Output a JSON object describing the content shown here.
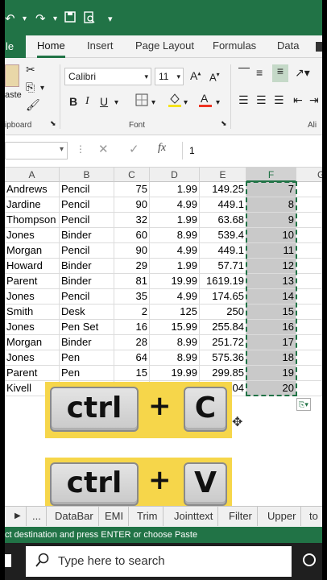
{
  "ribbon_tabs": [
    "le",
    "Home",
    "Insert",
    "Page Layout",
    "Formulas",
    "Data"
  ],
  "ribbon": {
    "font_name": "Calibri",
    "font_size": "11",
    "paste_label": "aste",
    "clipboard_label": "ipboard",
    "font_group_label": "Font",
    "alignment_label": "Ali"
  },
  "formula_bar": {
    "fx_label": "fx",
    "value": "1"
  },
  "columns": [
    "A",
    "B",
    "C",
    "D",
    "E",
    "F"
  ],
  "last_column_partial": "G",
  "rows": [
    [
      "Andrews",
      "Pencil",
      "75",
      "1.99",
      "149.25",
      "7"
    ],
    [
      "Jardine",
      "Pencil",
      "90",
      "4.99",
      "449.1",
      "8"
    ],
    [
      "Thompson",
      "Pencil",
      "32",
      "1.99",
      "63.68",
      "9"
    ],
    [
      "Jones",
      "Binder",
      "60",
      "8.99",
      "539.4",
      "10"
    ],
    [
      "Morgan",
      "Pencil",
      "90",
      "4.99",
      "449.1",
      "11"
    ],
    [
      "Howard",
      "Binder",
      "29",
      "1.99",
      "57.71",
      "12"
    ],
    [
      "Parent",
      "Binder",
      "81",
      "19.99",
      "1619.19",
      "13"
    ],
    [
      "Jones",
      "Pencil",
      "35",
      "4.99",
      "174.65",
      "14"
    ],
    [
      "Smith",
      "Desk",
      "2",
      "125",
      "250",
      "15"
    ],
    [
      "Jones",
      "Pen Set",
      "16",
      "15.99",
      "255.84",
      "16"
    ],
    [
      "Morgan",
      "Binder",
      "28",
      "8.99",
      "251.72",
      "17"
    ],
    [
      "Jones",
      "Pen",
      "64",
      "8.99",
      "575.36",
      "18"
    ],
    [
      "Parent",
      "Pen",
      "15",
      "19.99",
      "299.85",
      "19"
    ],
    [
      "Kivell",
      "",
      "",
      "",
      "04",
      "20"
    ]
  ],
  "overlay": {
    "key_ctrl": "ctrl",
    "plus": "+",
    "key_c": "C",
    "key_v": "V"
  },
  "sheet_tabs": [
    "...",
    "DataBar",
    "EMI",
    "Trim",
    "Jointtext",
    "Filter",
    "Upper",
    "to"
  ],
  "status_text": "ct destination and press ENTER or choose Paste",
  "taskbar": {
    "search_placeholder": "Type here to search"
  },
  "colors": {
    "excel_green": "#217346",
    "overlay_yellow": "#f6d64a",
    "selected_fill": "#c9c9c9"
  }
}
